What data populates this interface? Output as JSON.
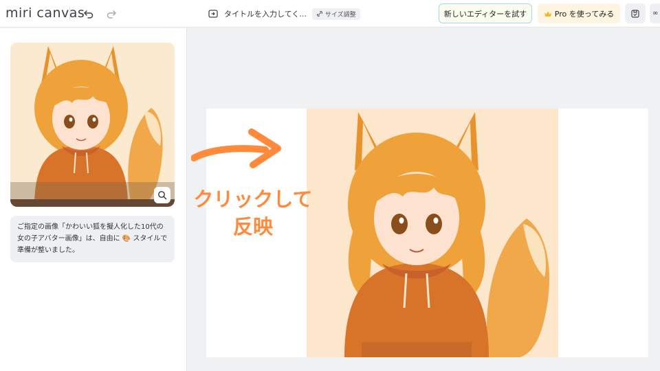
{
  "app": {
    "logo_text": "miri canvas"
  },
  "header": {
    "title_placeholder": "タイトルを入力してく...",
    "size_label": "サイズ調整",
    "new_editor_label": "新しいエディターを試す",
    "pro_label": "Pro を使ってみる",
    "partial_label": "∞"
  },
  "left_panel": {
    "message": "ご指定の画像「かわいい狐を擬人化した10代の女の子アバター画像」は、自由に 🎨 スタイルで準備が整いました。"
  },
  "annotation": {
    "text_line1": "クリックして",
    "text_line2": "反映"
  },
  "colors": {
    "accent_orange": "#ff8a3c",
    "new_editor_border": "#a6d9e8",
    "pro_bg": "#fdf4e2"
  },
  "icons": [
    "undo-icon",
    "redo-icon",
    "folder-arrow-icon",
    "link-icon",
    "crown-icon",
    "save-icon",
    "search-icon"
  ]
}
